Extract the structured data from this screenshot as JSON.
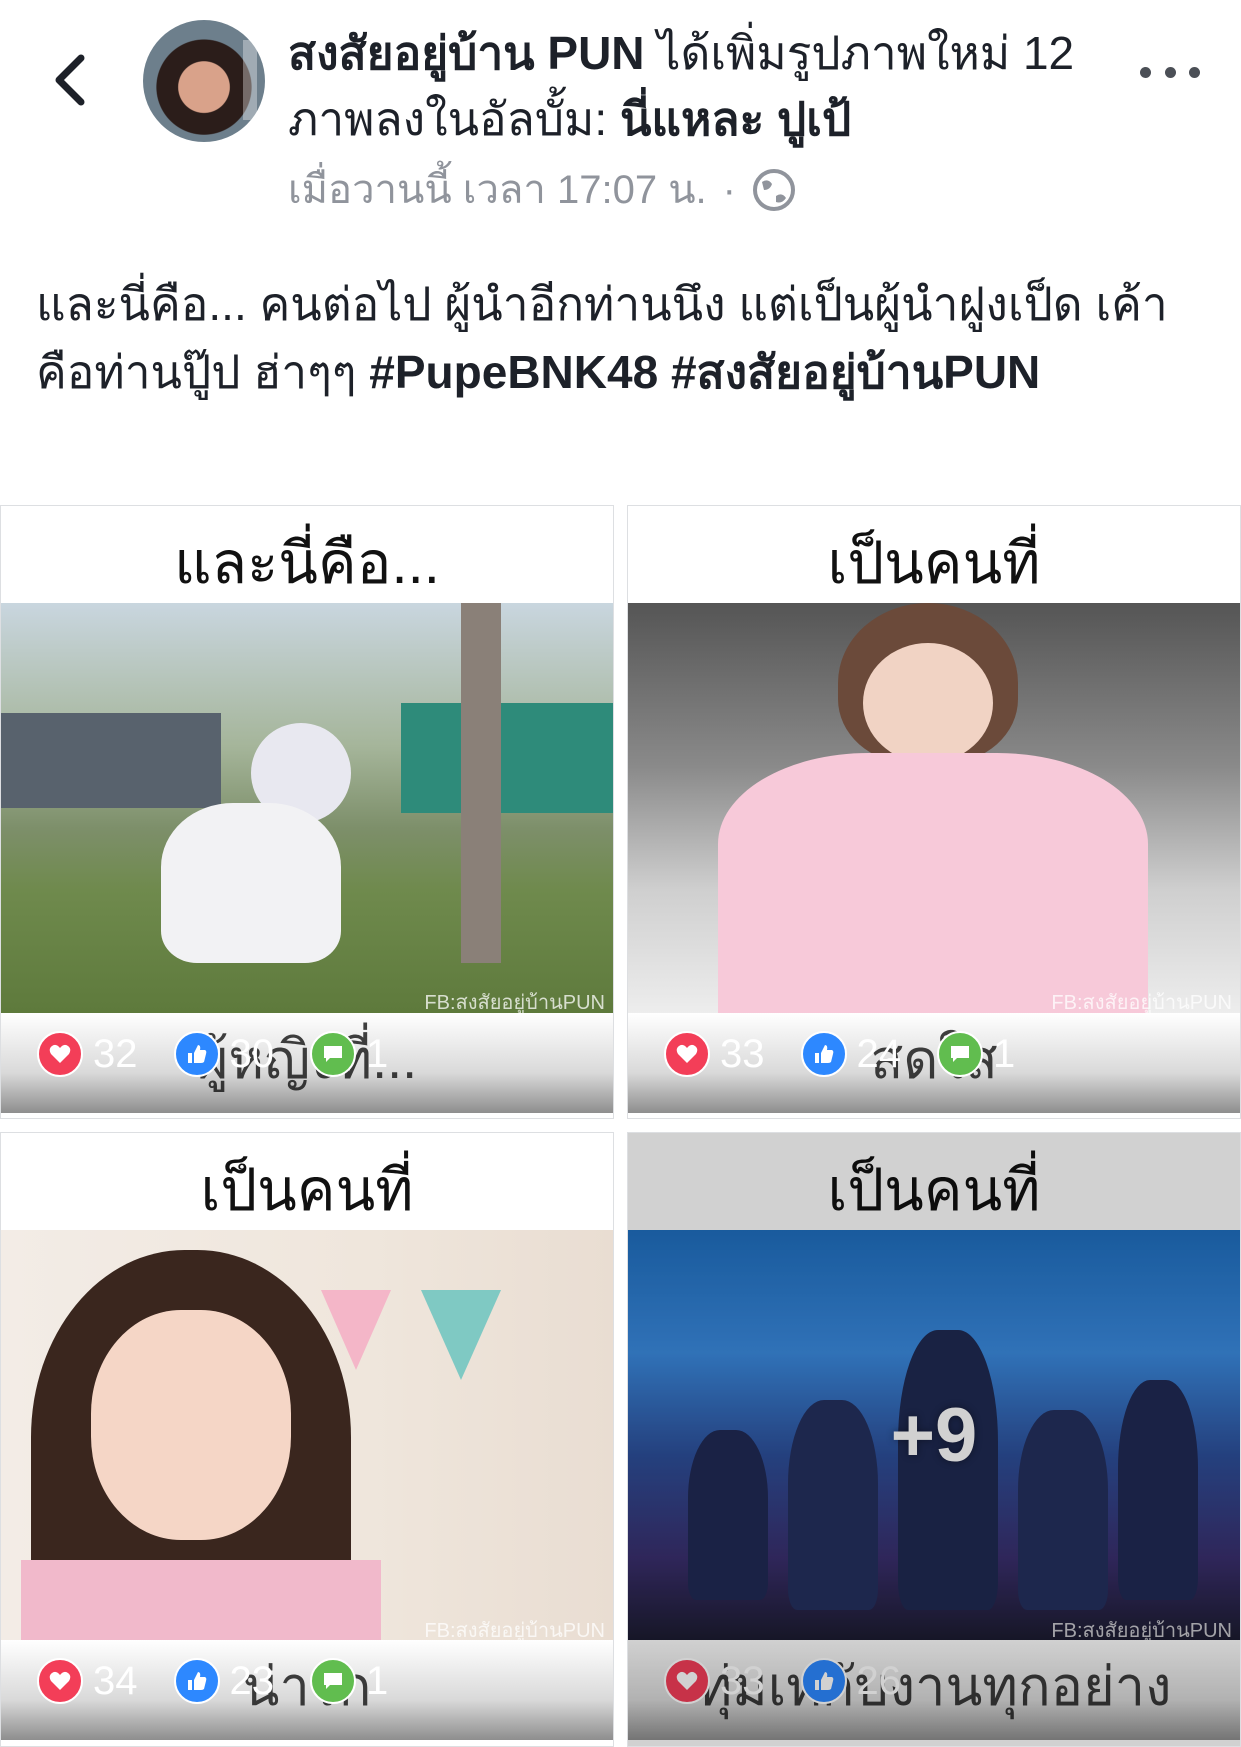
{
  "header": {
    "back_icon": "chevron-left-icon",
    "author": "สงสัยอยู่บ้าน PUN",
    "action_text": "ได้เพิ่มรูปภาพใหม่ 12 ภาพลงในอัลบั้ม:",
    "album_name": "นี่แหละ ปูเป้",
    "timestamp": "เมื่อวานนี้ เวลา 17:07 น.",
    "dot": "·",
    "privacy_icon": "globe-icon",
    "more_icon": "more-dots-icon"
  },
  "post": {
    "text": "และนี่คือ... คนต่อไป ผู้นำอีกท่านนึง แต่เป็นผู้นำฝูงเป็ด เค้าคือท่านปู๊ป ฮ่าๆๆ",
    "hashtag1": "#PupeBNK48",
    "hashtag2": "#สงสัยอยู่บ้านPUN"
  },
  "tiles": [
    {
      "caption": "และนี่คือ...",
      "bottom_caption": "ผู้หญิงที่...",
      "watermark": "FB:สงสัยอยู่บ้านPUN",
      "love": "32",
      "like": "30",
      "comment": "1"
    },
    {
      "caption": "เป็นคนที่",
      "bottom_caption": "สดใส",
      "watermark": "FB:สงสัยอยู่บ้านPUN",
      "love": "33",
      "like": "24",
      "comment": "1"
    },
    {
      "caption": "เป็นคนที่",
      "bottom_caption": "น่ารัก",
      "watermark": "FB:สงสัยอยู่บ้านPUN",
      "love": "34",
      "like": "23",
      "comment": "1"
    },
    {
      "caption": "เป็นคนที่",
      "bottom_caption": "ทุ่มเทกับงานทุกอย่าง",
      "watermark": "FB:สงสัยอยู่บ้านPUN",
      "love": "33",
      "like": "26",
      "more": "+9"
    }
  ],
  "colors": {
    "love": "#f33e58",
    "like": "#2d88ff",
    "comment": "#61bd4f",
    "meta": "#90949c"
  }
}
